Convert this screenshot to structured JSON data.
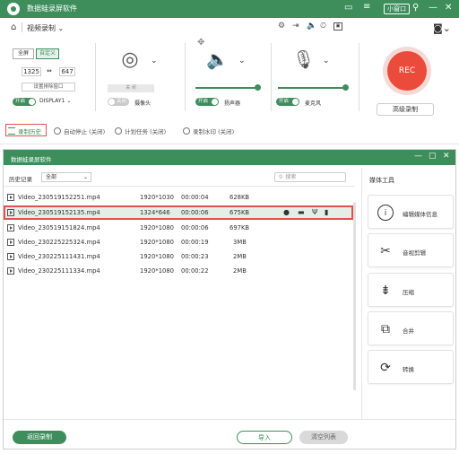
{
  "app": {
    "title": "数据蛙录屏软件",
    "mini_window": "小窗口"
  },
  "mode": {
    "label": "视频录制"
  },
  "screen_panel": {
    "fullscreen": "全屏",
    "custom": "自定义",
    "width": "1325",
    "height": "647",
    "set_exclude": "设置排除窗口",
    "toggle_on": "开启",
    "display": "DISPLAY1"
  },
  "camera_panel": {
    "off_btn": "关 闭",
    "toggle_off": "关闭",
    "label": "摄像头"
  },
  "speaker_panel": {
    "toggle_on": "开启",
    "label": "扬声器"
  },
  "mic_panel": {
    "toggle_on": "开启",
    "label": "麦克风"
  },
  "rec": {
    "button": "REC",
    "advanced": "高级录制"
  },
  "toolbar": {
    "history": "录制历史",
    "auto_stop": "自动停止 (关闭)",
    "schedule": "计划任务 (关闭)",
    "watermark": "录制水印 (关闭)"
  },
  "dialog": {
    "title": "数据蛙录屏软件",
    "history_label": "历史记录",
    "filter_value": "全部",
    "search_placeholder": "搜索",
    "media_tools_title": "媒体工具",
    "back_button": "返回录制",
    "import_button": "导入",
    "clear_button": "清空列表"
  },
  "files": [
    {
      "name": "Video_230519152251.mp4",
      "res": "1920*1030",
      "dur": "00:00:04",
      "size": "628KB"
    },
    {
      "name": "Video_230519152135.mp4",
      "res": "1324*646",
      "dur": "00:00:06",
      "size": "675KB"
    },
    {
      "name": "Video_230519151824.mp4",
      "res": "1920*1080",
      "dur": "00:00:06",
      "size": "697KB"
    },
    {
      "name": "Video_230225225324.mp4",
      "res": "1920*1080",
      "dur": "00:00:19",
      "size": "3MB"
    },
    {
      "name": "Video_230225111431.mp4",
      "res": "1920*1080",
      "dur": "00:00:23",
      "size": "2MB"
    },
    {
      "name": "Video_230225111334.mp4",
      "res": "1920*1080",
      "dur": "00:00:22",
      "size": "2MB"
    }
  ],
  "media_tools": [
    {
      "label": "编辑媒体信息",
      "icon": "info-icon"
    },
    {
      "label": "音视剪辑",
      "icon": "scissors-icon"
    },
    {
      "label": "压缩",
      "icon": "compress-icon"
    },
    {
      "label": "合并",
      "icon": "merge-icon"
    },
    {
      "label": "转换",
      "icon": "convert-icon"
    }
  ],
  "colors": {
    "brand": "#3e8e5c",
    "rec": "#ea4b3a",
    "highlight": "#e05252"
  }
}
